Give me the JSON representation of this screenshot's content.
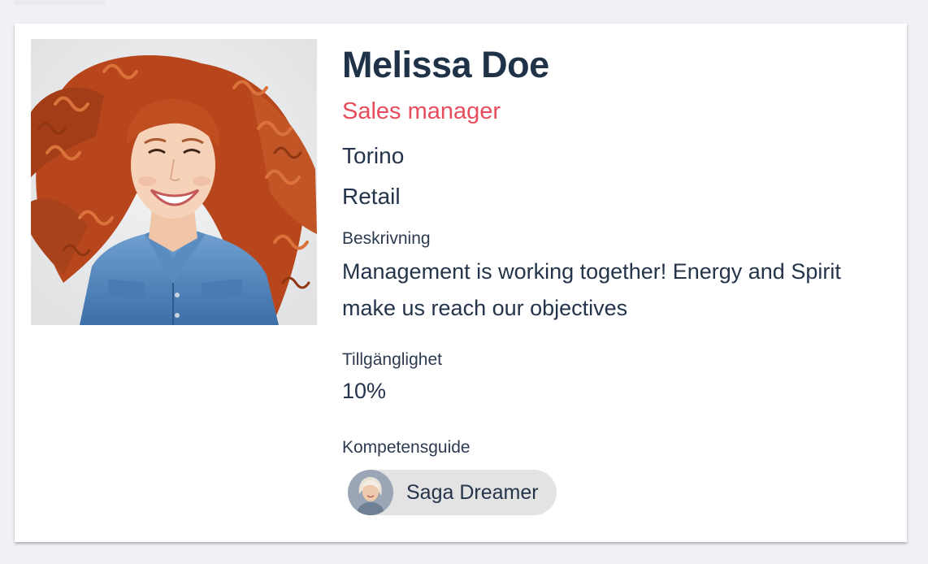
{
  "profile": {
    "name": "Melissa Doe",
    "role": "Sales manager",
    "city": "Torino",
    "industry": "Retail",
    "description_label": "Beskrivning",
    "description": "Management is working together! Energy and Spirit make us reach our objectives",
    "availability_label": "Tillgänglighet",
    "availability": "10%",
    "guide_label": "Kompetensguide",
    "guide_name": "Saga Dreamer"
  },
  "colors": {
    "role_accent": "#e84d5d",
    "text_primary": "#1f3248",
    "chip_background": "#e3e3e3",
    "page_background": "#f0f0f5"
  }
}
